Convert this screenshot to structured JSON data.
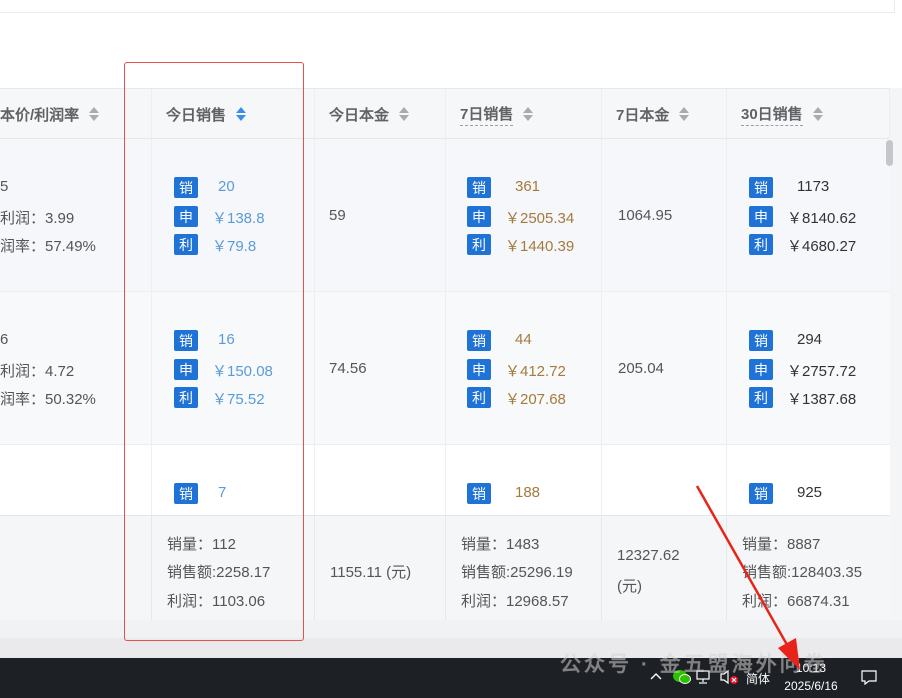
{
  "columns": {
    "cost_profit_label": "本价/利润率",
    "today_sales_label": "今日销售",
    "today_cost_label": "今日本金",
    "sales_7d_label": "7日销售",
    "cost_7d_label": "7日本金",
    "sales_30d_label": "30日销售"
  },
  "tags": {
    "sales": "销",
    "amount": "申",
    "profit": "利"
  },
  "rows": [
    {
      "left_line1": "5",
      "left_line2": "利润：3.99",
      "left_line3": "润率：57.49%",
      "today_sales": {
        "qty": "20",
        "amount": "￥138.8",
        "profit": "￥79.8"
      },
      "today_cost": "59",
      "sales_7d": {
        "qty": "361",
        "amount": "￥2505.34",
        "profit": "￥1440.39"
      },
      "cost_7d": "1064.95",
      "sales_30d": {
        "qty": "1173",
        "amount": "￥8140.62",
        "profit": "￥4680.27"
      }
    },
    {
      "left_line1": "6",
      "left_line2": "利润：4.72",
      "left_line3": "润率：50.32%",
      "today_sales": {
        "qty": "16",
        "amount": "￥150.08",
        "profit": "￥75.52"
      },
      "today_cost": "74.56",
      "sales_7d": {
        "qty": "44",
        "amount": "￥412.72",
        "profit": "￥207.68"
      },
      "cost_7d": "205.04",
      "sales_30d": {
        "qty": "294",
        "amount": "￥2757.72",
        "profit": "￥1387.68"
      }
    },
    {
      "today_sales": {
        "qty": "7"
      },
      "sales_7d": {
        "qty": "188"
      },
      "sales_30d": {
        "qty": "925"
      }
    }
  ],
  "summary": {
    "today_sales": {
      "qty": "销量：112",
      "amount": "销售额:2258.17",
      "profit": "利润：1103.06"
    },
    "today_cost": "1155.11 (元)",
    "sales_7d": {
      "qty": "销量：1483",
      "amount": "销售额:25296.19",
      "profit": "利润：12968.57"
    },
    "cost_7d_line1": "12327.62",
    "cost_7d_line2": "(元)",
    "sales_30d": {
      "qty": "销量：8887",
      "amount": "销售额:128403.35",
      "profit": "利润：66874.31"
    }
  },
  "taskbar": {
    "ime": "简体",
    "time": "10:13",
    "date": "2025/6/16"
  },
  "watermark": "公众号 · 金五盟海外问卷",
  "colors": {
    "tag_blue": "#1f73d6",
    "today_value": "#5b9bd8",
    "week_value": "#a57b3c",
    "highlight_red": "#e8504a",
    "sort_active": "#3a8ee6"
  }
}
